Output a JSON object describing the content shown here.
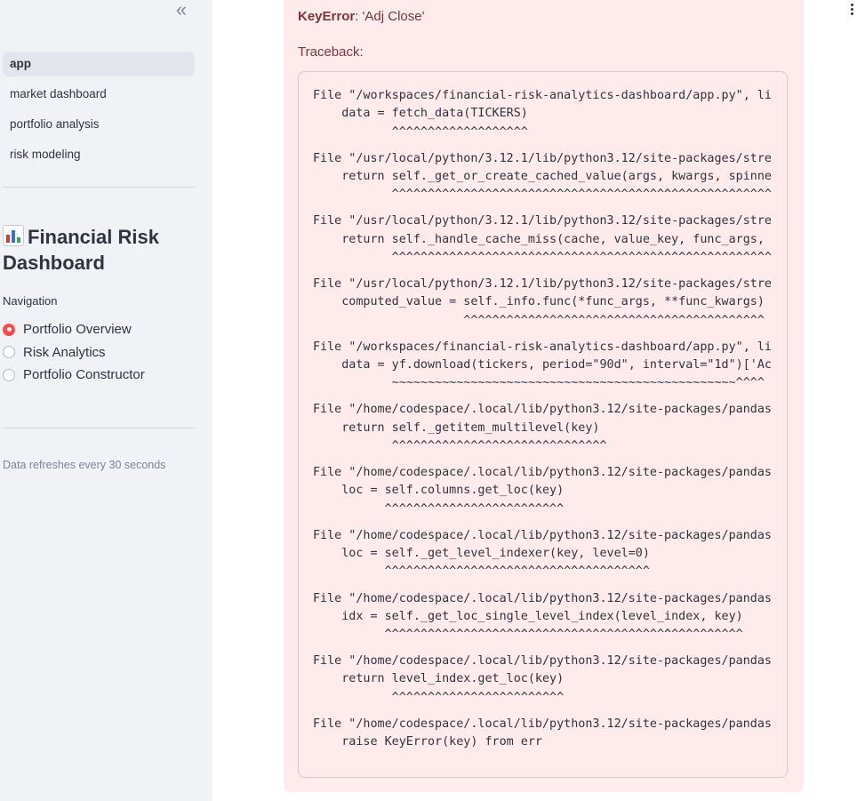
{
  "sidebar": {
    "collapse_icon": "double-chevron-left-icon",
    "collapse_glyph": "«",
    "pages": [
      {
        "label": "app",
        "active": true
      },
      {
        "label": "market dashboard",
        "active": false
      },
      {
        "label": "portfolio analysis",
        "active": false
      },
      {
        "label": "risk modeling",
        "active": false
      }
    ],
    "title": "Financial Risk Dashboard",
    "title_icon": "bar-chart-emoji-icon",
    "navigation_label": "Navigation",
    "radio_options": [
      {
        "label": "Portfolio Overview",
        "checked": true
      },
      {
        "label": "Risk Analytics",
        "checked": false
      },
      {
        "label": "Portfolio Constructor",
        "checked": false
      }
    ],
    "refresh_caption": "Data refreshes every 30 seconds"
  },
  "main": {
    "menu_icon": "vertical-ellipsis-icon",
    "error": {
      "type": "KeyError",
      "message": ": 'Adj Close'",
      "traceback_label": "Traceback:",
      "frames": [
        [
          "File \"/workspaces/financial-risk-analytics-dashboard/app.py\", li",
          "    data = fetch_data(TICKERS)",
          "           ^^^^^^^^^^^^^^^^^^^"
        ],
        [
          "File \"/usr/local/python/3.12.1/lib/python3.12/site-packages/stre",
          "    return self._get_or_create_cached_value(args, kwargs, spinne",
          "           ^^^^^^^^^^^^^^^^^^^^^^^^^^^^^^^^^^^^^^^^^^^^^^^^^^^^^"
        ],
        [
          "File \"/usr/local/python/3.12.1/lib/python3.12/site-packages/stre",
          "    return self._handle_cache_miss(cache, value_key, func_args, ",
          "           ^^^^^^^^^^^^^^^^^^^^^^^^^^^^^^^^^^^^^^^^^^^^^^^^^^^^^"
        ],
        [
          "File \"/usr/local/python/3.12.1/lib/python3.12/site-packages/stre",
          "    computed_value = self._info.func(*func_args, **func_kwargs)",
          "                     ^^^^^^^^^^^^^^^^^^^^^^^^^^^^^^^^^^^^^^^^^^"
        ],
        [
          "File \"/workspaces/financial-risk-analytics-dashboard/app.py\", li",
          "    data = yf.download(tickers, period=\"90d\", interval=\"1d\")['Ac",
          "           ~~~~~~~~~~~~~~~~~~~~~~~~~~~~~~~~~~~~~~~~~~~~~~~~^^^^"
        ],
        [
          "File \"/home/codespace/.local/lib/python3.12/site-packages/pandas",
          "    return self._getitem_multilevel(key)",
          "           ^^^^^^^^^^^^^^^^^^^^^^^^^^^^^^"
        ],
        [
          "File \"/home/codespace/.local/lib/python3.12/site-packages/pandas",
          "    loc = self.columns.get_loc(key)",
          "          ^^^^^^^^^^^^^^^^^^^^^^^^^"
        ],
        [
          "File \"/home/codespace/.local/lib/python3.12/site-packages/pandas",
          "    loc = self._get_level_indexer(key, level=0)",
          "          ^^^^^^^^^^^^^^^^^^^^^^^^^^^^^^^^^^^^^"
        ],
        [
          "File \"/home/codespace/.local/lib/python3.12/site-packages/pandas",
          "    idx = self._get_loc_single_level_index(level_index, key)",
          "          ^^^^^^^^^^^^^^^^^^^^^^^^^^^^^^^^^^^^^^^^^^^^^^^^^^"
        ],
        [
          "File \"/home/codespace/.local/lib/python3.12/site-packages/pandas",
          "    return level_index.get_loc(key)",
          "           ^^^^^^^^^^^^^^^^^^^^^^^^"
        ],
        [
          "File \"/home/codespace/.local/lib/python3.12/site-packages/pandas",
          "    raise KeyError(key) from err"
        ]
      ]
    }
  },
  "colors": {
    "sidebar_bg": "#f0f2f6",
    "error_bg": "#ffebeb",
    "error_text": "#7d353b",
    "accent": "#ff4b4b"
  }
}
